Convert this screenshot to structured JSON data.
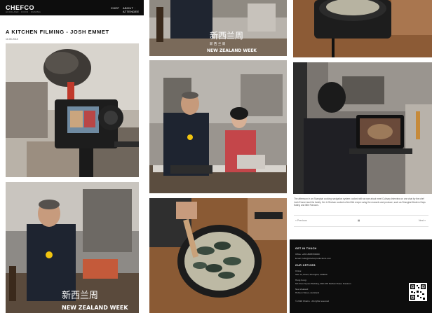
{
  "header": {
    "logo": "CHEFCO",
    "tagline": "AUCKLAND · FOOD · FILMING",
    "nav": [
      "CHEF",
      "ABOUT · ATTENDEE"
    ]
  },
  "post": {
    "title": "A KITCHEN FILMING - JOSH EMMET",
    "date": "16.05.2018"
  },
  "photo_text": {
    "brand_cn": "新西兰周",
    "brand_cn_sub": "新 西 兰 周",
    "brand_en": "NEW ZEALAND WEEK"
  },
  "article": {
    "paragraph": "The afternoon in an Shanghai cooking navigation system cooked with an eye about meet Culinary Interview on one chat by the chef Josh Emmet and the family. Her & Shuhan cooked a fish fillet recipe using the mussels and produce, such as Shanghai Modern Days Eating and little Flavours."
  },
  "pager": {
    "prev": "« Previous",
    "grid": "▦",
    "next": "Next »"
  },
  "footer": {
    "get_in_touch": "GET IN TOUCH",
    "contact_lines": [
      "Office: +86 18688700000",
      "Email: hello@chefcoproductions.com"
    ],
    "our_offices": "OUR OFFICES",
    "offices": [
      "China:",
      "Site 14, Road, Shanghai, 200040",
      "Hong Kong:",
      "6th Floor Nyuen Building, 900-978 Nathan Road, Kowloon",
      "New Zealand:",
      "Hobson Street, Auckland"
    ],
    "copyright": "© 2018 Chefco · All rights reserved"
  }
}
